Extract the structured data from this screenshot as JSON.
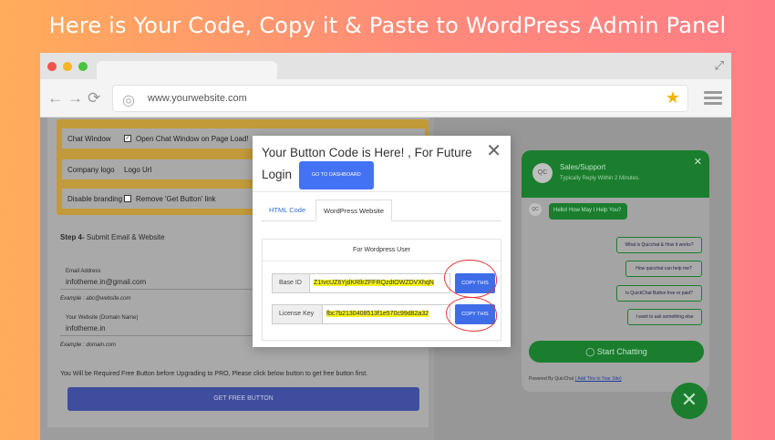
{
  "headline": "Here is Your Code, Copy it & Paste to WordPress Admin Panel",
  "browser": {
    "url": "www.yourwebsite.com",
    "nav": {
      "back_icon": "←",
      "forward_icon": "→",
      "reload_icon": "⟳"
    }
  },
  "settings": {
    "chat_window_label": "Chat Window",
    "chat_window_option": "Open Chat Window on Page Load!",
    "company_logo_label": "Company logo",
    "company_logo_value": "Logo Url",
    "branding_label": "Disable branding",
    "branding_option": "Remove 'Get Button' link",
    "step4_prefix": "Step 4-",
    "step4_text": "Submit Email & Website",
    "email_label": "Email Address",
    "email_value": "infotheme.in@gmail.com",
    "email_example": "Example : abc@website.com",
    "website_label": "Your Website (Domain Name)",
    "website_value": "infotheme.in",
    "website_example": "Example : domain.com",
    "notice": "You Will be Required Free Button before Upgrading to PRO, Please click below button to get free button first.",
    "get_free_button": "GET FREE BUTTON"
  },
  "widget": {
    "avatar": "QC",
    "name": "Sales/Support",
    "subtitle": "Typically Reply Within 2 Minutes.",
    "close": "✕",
    "greeting": "Hello! How May I Help You?",
    "options": [
      "What is Quicchat & How it works?",
      "How quicchat can help me?",
      "Is QuickChat Button free or paid?",
      "I want to ask something else"
    ],
    "start_button": "Start Chatting",
    "powered_prefix": "Powered By QuicChat",
    "powered_link": "( Add This to Your Site)",
    "fab_icon": "✕"
  },
  "modal": {
    "title": "Your Button Code is Here! , For Future Login",
    "goto_button": "GO TO DASHBOARD",
    "close": "✕",
    "tabs": [
      {
        "label": "HTML Code",
        "active": false
      },
      {
        "label": "WordPress Website",
        "active": true
      }
    ],
    "panel_title": "For Wordpress User",
    "base_id_label": "Base ID",
    "base_id_value": "Z1IvcUZ6YjdKRllrZFFRQzdtOWZDVXhqN",
    "license_label": "License Key",
    "license_value": "fbc7b2130408513f1e570c99d82a32",
    "copy_label": "COPY THIS"
  },
  "colors": {
    "accent_blue": "#3f6de8",
    "highlight": "#f4f21d",
    "annotation_red": "#e23a3a",
    "chat_green": "#1a7e2e"
  }
}
